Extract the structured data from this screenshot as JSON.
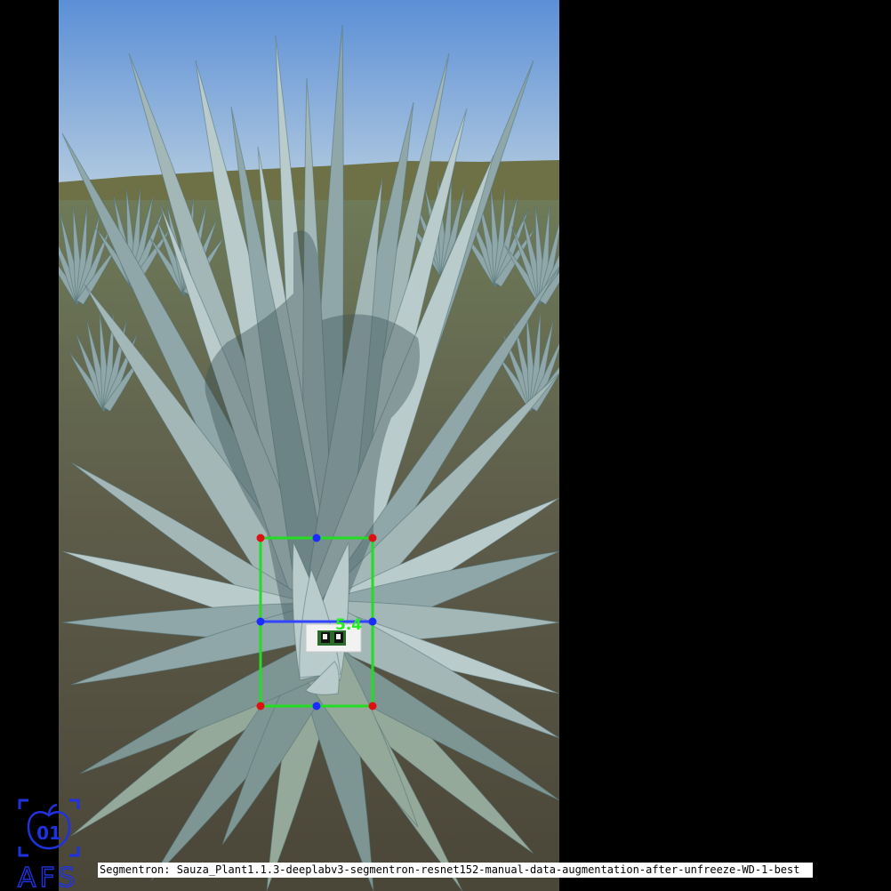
{
  "photo": {
    "subject": "blue agave plant in a field",
    "colors": {
      "sky_top": "#5b8fd6",
      "sky_bottom": "#a9c6e0",
      "hills": "#6e7045",
      "field": "#6d6a52",
      "leaf": "#8fa7a8",
      "leaf_light": "#b9cbcb",
      "leaf_dark": "#4f6d71",
      "shadow": "#3f5459"
    }
  },
  "annotation": {
    "box_color": "#22dd22",
    "corner_color": "#dd1111",
    "midpoint_color": "#1c2cff",
    "midline_color": "#3344ff",
    "label": "5.4",
    "label_color": "#22ee22"
  },
  "logo": {
    "badge": "01",
    "text": "AFS",
    "color": "#2032e0"
  },
  "caption": "Segmentron: Sauza_Plant1.1.3-deeplabv3-segmentron-resnet152-manual-data-augmentation-after-unfreeze-WD-1-best"
}
